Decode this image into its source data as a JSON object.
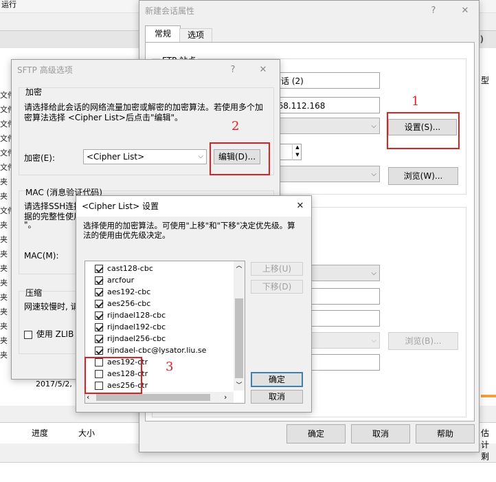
{
  "background": {
    "toolbar_label": "运行",
    "right_partial": "d)",
    "right_label": "型",
    "left_rows": [
      "文件",
      "文件",
      "文件",
      "文件",
      "文件",
      "文件",
      "夹",
      "夹",
      "文件",
      "夹",
      "夹",
      "夹",
      "夹",
      "夹",
      "夹",
      "夹",
      "夹",
      "夹",
      "夹"
    ],
    "date_row": "2017/5/2,",
    "bottom_cols": {
      "progress": "进度",
      "size": "大小",
      "right": "估计剩"
    }
  },
  "session_dialog": {
    "title": "新建会话属性",
    "help": "?",
    "close": "✕",
    "tabs": [
      "常规",
      "选项"
    ],
    "active_tab": 0,
    "group_title": "FTP 站点",
    "name_value": "会话 (2)",
    "host_value": "168.112.168",
    "setup_button": "设置(S)...",
    "browse_button": "浏览(W)...",
    "browse_button2": "浏览(B)...",
    "ok": "确定",
    "cancel": "取消",
    "help_button": "帮助"
  },
  "sftp_dialog": {
    "title": "SFTP 高级选项",
    "help": "?",
    "close": "✕",
    "encryption_title": "加密",
    "encryption_desc": "请选择给此会话的网络流量加密或解密的加密算法。若使用多个加密算法选择 <Cipher List>后点击\"编辑\"。",
    "encryption_label": "加密(E):",
    "encryption_value": "<Cipher List>",
    "edit_button": "编辑(D)...",
    "mac_title": "MAC (消息验证代码)",
    "mac_desc_1": "请选择SSH连接",
    "mac_desc_2": "据的完整性使用",
    "mac_desc_3": "\"。",
    "mac_label": "MAC(M):",
    "compress_title": "压缩",
    "compress_desc": "网速较慢时, 请",
    "zlib_label": "使用 ZLIB 压"
  },
  "cipher_dialog": {
    "title": "<Cipher List> 设置",
    "close": "✕",
    "desc": "选择使用的加密算法。可使用\"上移\"和\"下移\"决定优先级。算法的使用由优先级决定。",
    "items": [
      {
        "name": "cast128-cbc",
        "checked": true
      },
      {
        "name": "arcfour",
        "checked": true
      },
      {
        "name": "aes192-cbc",
        "checked": true
      },
      {
        "name": "aes256-cbc",
        "checked": true
      },
      {
        "name": "rijndael128-cbc",
        "checked": true
      },
      {
        "name": "rijndael192-cbc",
        "checked": true
      },
      {
        "name": "rijndael256-cbc",
        "checked": true
      },
      {
        "name": "rijndael-cbc@lysator.liu.se",
        "checked": true
      },
      {
        "name": "aes192-ctr",
        "checked": false
      },
      {
        "name": "aes128-ctr",
        "checked": false
      },
      {
        "name": "aes256-ctr",
        "checked": false
      }
    ],
    "move_up": "上移(U)",
    "move_down": "下移(D)",
    "ok": "确定",
    "cancel": "取消"
  },
  "annotations": {
    "n1": "1",
    "n2": "2",
    "n3": "3"
  },
  "colors": {
    "annotation": "#e02020",
    "default_button_border": "#3c7fb1"
  }
}
